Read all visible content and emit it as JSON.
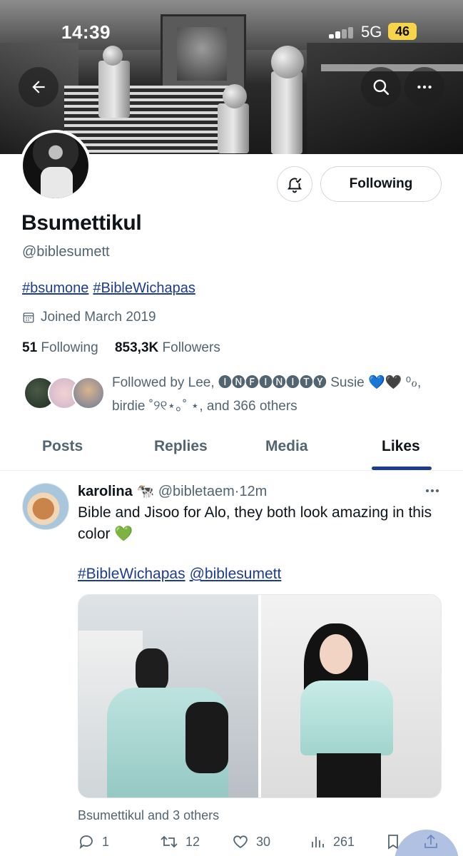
{
  "status_bar": {
    "time": "14:39",
    "network": "5G",
    "battery": "46"
  },
  "header": {
    "back_label": "Back",
    "search_label": "Search",
    "more_label": "More"
  },
  "profile": {
    "name": "Bsumettikul",
    "handle": "@biblesumett",
    "hashtags": [
      "#bsumone",
      "#BibleWichapas"
    ],
    "joined": "Joined March 2019",
    "following_count": "51",
    "following_label": "Following",
    "followers_count": "853,3K",
    "followers_label": "Followers",
    "followed_by_line1": "Followed by Lee, 🅘🅝🅕🅘🅝🅘🅣🅨 Susie 💙🖤 ⁰ℴ,",
    "followed_by_line2": "birdie ˚୨୧⋆｡˚ ⋆, and 366 others",
    "follow_button": "Following"
  },
  "tabs": [
    "Posts",
    "Replies",
    "Media",
    "Likes"
  ],
  "active_tab": "Likes",
  "tweet": {
    "display_name": "karolina 🐄",
    "handle": "@bibletaem",
    "time": "12m",
    "text": "Bible and Jisoo for Alo, they both look amazing in this color 💚",
    "links": [
      "#BibleWichapas",
      "@biblesumett"
    ],
    "liked_by": "Bsumettikul and 3 others",
    "reply_count": "1",
    "retweet_count": "12",
    "like_count": "30",
    "view_count": "261"
  },
  "colors": {
    "link": "#1d3c8f",
    "muted": "#536471",
    "text": "#0f1419",
    "battery": "#f7d54b"
  }
}
